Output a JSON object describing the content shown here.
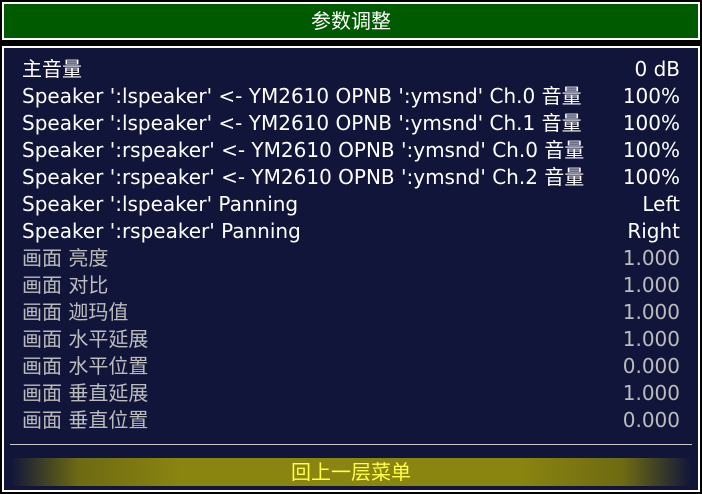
{
  "header": {
    "title": "参数调整"
  },
  "menu": {
    "items": [
      {
        "label": "主音量",
        "value": "0 dB",
        "style": "normal"
      },
      {
        "label": "Speaker ':lspeaker' <- YM2610 OPNB ':ymsnd' Ch.0 音量",
        "value": "100%",
        "style": "normal"
      },
      {
        "label": "Speaker ':lspeaker' <- YM2610 OPNB ':ymsnd' Ch.1 音量",
        "value": "100%",
        "style": "normal"
      },
      {
        "label": "Speaker ':rspeaker' <- YM2610 OPNB ':ymsnd' Ch.0 音量",
        "value": "100%",
        "style": "normal"
      },
      {
        "label": "Speaker ':rspeaker' <- YM2610 OPNB ':ymsnd' Ch.2 音量",
        "value": "100%",
        "style": "normal"
      },
      {
        "label": "Speaker ':lspeaker' Panning",
        "value": "Left",
        "style": "normal"
      },
      {
        "label": "Speaker ':rspeaker' Panning",
        "value": "Right",
        "style": "normal"
      },
      {
        "label": "画面 亮度",
        "value": "1.000",
        "style": "dim"
      },
      {
        "label": "画面 对比",
        "value": "1.000",
        "style": "dim"
      },
      {
        "label": "画面 迦玛值",
        "value": "1.000",
        "style": "dim"
      },
      {
        "label": "画面 水平延展",
        "value": "1.000",
        "style": "dim"
      },
      {
        "label": "画面 水平位置",
        "value": "0.000",
        "style": "dim"
      },
      {
        "label": "画面 垂直延展",
        "value": "1.000",
        "style": "dim"
      },
      {
        "label": "画面 垂直位置",
        "value": "0.000",
        "style": "dim"
      }
    ]
  },
  "footer": {
    "back_label": "回上一层菜单"
  },
  "colors": {
    "header_bg": "#005a00",
    "panel_bg": "#101539",
    "text": "#ffffff",
    "text_dim": "#bcbcbc",
    "highlight_bg": "#8a8410",
    "highlight_text": "#ffff44"
  }
}
